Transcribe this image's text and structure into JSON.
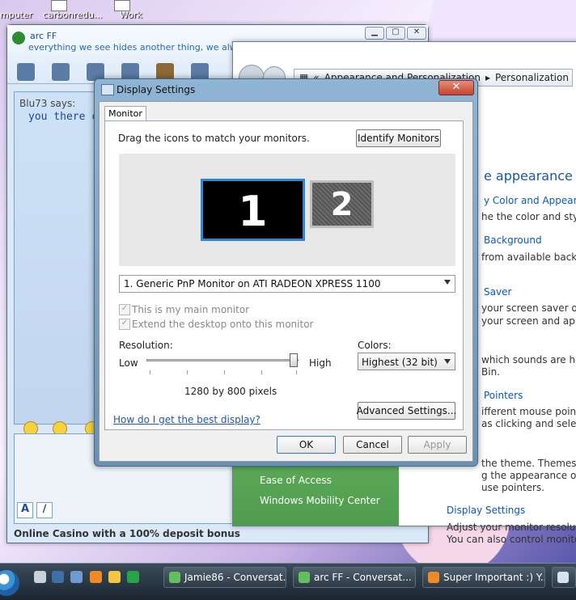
{
  "desktop": {
    "labels": [
      "mputer",
      "carbonredu...",
      "Work"
    ]
  },
  "messenger": {
    "contact": "arc     FF",
    "status": "everything we see hides another thing, we alwa...",
    "says": "Blu73 says:",
    "message": "you there c",
    "footer": "Online Casino with a 100% deposit bonus"
  },
  "control_panel": {
    "breadcrumb_1": "Appearance and Personalization",
    "breadcrumb_2": "Personalization",
    "heading": "e appearance and",
    "links": [
      {
        "text": "y Color and Appearance",
        "desc": "he the color and style of"
      },
      {
        "text": "Background",
        "desc": "from available backgro"
      },
      {
        "text": "Saver",
        "desc": "your screen saver or ac"
      },
      {
        "text": "",
        "desc": "your screen and appear"
      },
      {
        "text": "",
        "desc": "which sounds are hear"
      },
      {
        "text": "",
        "desc": "Bin."
      },
      {
        "text": "Pointers",
        "desc": "ifferent mouse pointer."
      },
      {
        "text": "",
        "desc": "as clicking and selectio"
      },
      {
        "text": "",
        "desc": "the theme. Themes ca"
      },
      {
        "text": "",
        "desc": "g the appearance of m"
      },
      {
        "text": "",
        "desc": "use pointers."
      }
    ],
    "left_links": [
      "Ease of Access",
      "Windows Mobility Center"
    ],
    "display_title": "Display Settings",
    "display_desc_1": "Adjust your monitor resolution",
    "display_desc_2": "You can also control monitor fi"
  },
  "dialog": {
    "title": "Display Settings",
    "tab": "Monitor",
    "drag_text": "Drag the icons to match your monitors.",
    "identify_button": "Identify Monitors",
    "monitor1": "1",
    "monitor2": "2",
    "monitor_select": "1. Generic PnP Monitor on ATI RADEON XPRESS 1100",
    "checkbox_main": "This is my main monitor",
    "checkbox_extend": "Extend the desktop onto this monitor",
    "resolution_label": "Resolution:",
    "low": "Low",
    "high": "High",
    "resolution_value": "1280 by 800 pixels",
    "colors_label": "Colors:",
    "colors_value": "Highest (32 bit)",
    "help_link": "How do I get the best display?",
    "advanced_button": "Advanced Settings...",
    "ok": "OK",
    "cancel": "Cancel",
    "apply": "Apply",
    "resolution_level": 0.95
  },
  "taskbar": {
    "items": [
      "Jamie86 - Conversat...",
      "arc      FF - Conversat...",
      "Super Important :) Y..."
    ]
  }
}
